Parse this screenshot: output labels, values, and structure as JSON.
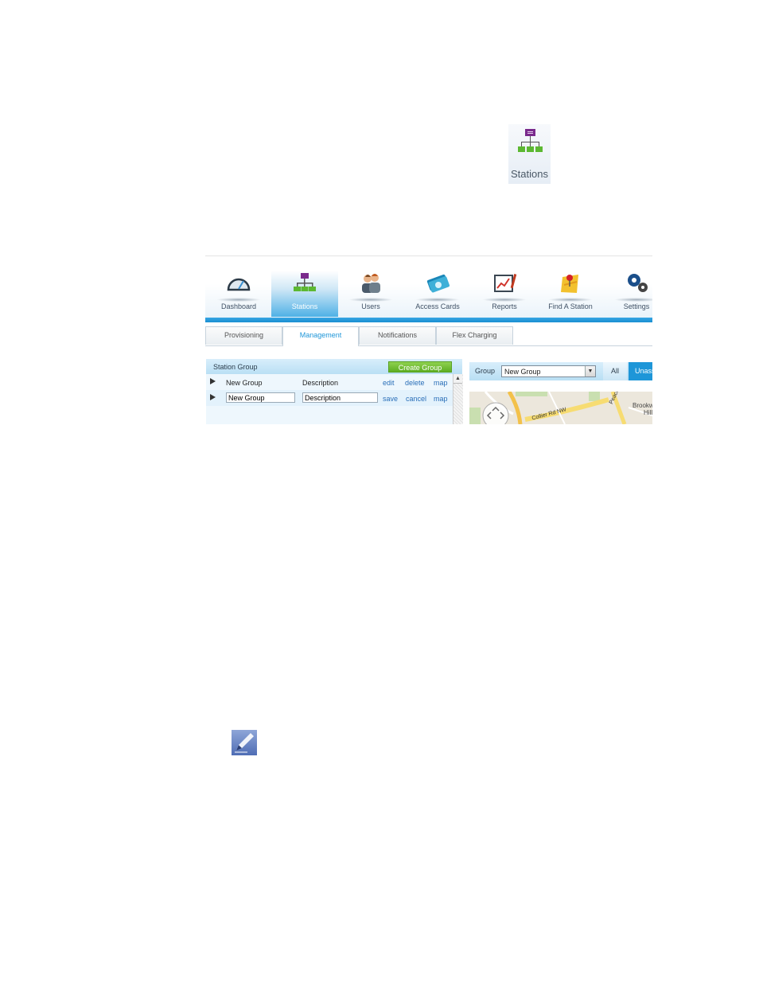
{
  "standalone_icon": {
    "label": "Stations",
    "icon": "stations-icon"
  },
  "nav": {
    "items": [
      {
        "label": "Dashboard",
        "icon": "speedometer-icon",
        "active": false
      },
      {
        "label": "Stations",
        "icon": "stations-icon",
        "active": true
      },
      {
        "label": "Users",
        "icon": "users-icon",
        "active": false
      },
      {
        "label": "Access Cards",
        "icon": "access-cards-icon",
        "active": false
      },
      {
        "label": "Reports",
        "icon": "reports-chart-icon",
        "active": false
      },
      {
        "label": "Find A Station",
        "icon": "map-pin-icon",
        "active": false
      },
      {
        "label": "Settings",
        "icon": "gears-icon",
        "active": false
      }
    ],
    "accent": "#1e96d8"
  },
  "tabs": [
    {
      "label": "Provisioning",
      "active": false
    },
    {
      "label": "Management",
      "active": true
    },
    {
      "label": "Notifications",
      "active": false
    },
    {
      "label": "Flex Charging",
      "active": false
    }
  ],
  "station_group": {
    "title": "Station Group",
    "create_button": "Create Group",
    "rows": [
      {
        "name": "New Group",
        "description": "Description",
        "links": [
          "edit",
          "delete",
          "map"
        ]
      }
    ],
    "edit_row": {
      "name_value": "New Group",
      "description_value": "Description",
      "links": [
        "save",
        "cancel",
        "map"
      ]
    }
  },
  "map_panel": {
    "group_label": "Group",
    "group_select": "New Group",
    "all_button": "All",
    "unassigned_button": "Unass",
    "map_labels": {
      "road": "Collier Rd NW",
      "street": "Peachtree",
      "area": "Brookw",
      "area2": "Hill"
    }
  },
  "note_icon": "pen-note-icon"
}
